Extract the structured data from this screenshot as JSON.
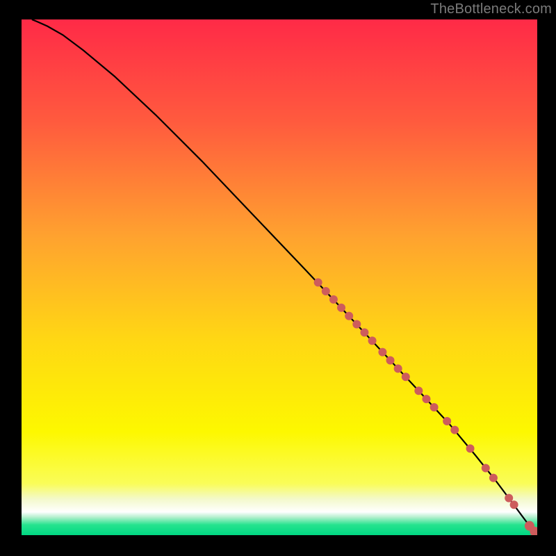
{
  "attribution": "TheBottleneck.com",
  "gradient": {
    "stops": [
      {
        "offset": 0.0,
        "color": "#ff2a47"
      },
      {
        "offset": 0.2,
        "color": "#ff5b3e"
      },
      {
        "offset": 0.42,
        "color": "#ffa22f"
      },
      {
        "offset": 0.62,
        "color": "#ffd714"
      },
      {
        "offset": 0.8,
        "color": "#fdf800"
      },
      {
        "offset": 0.9,
        "color": "#fafd58"
      },
      {
        "offset": 0.93,
        "color": "#f3f9cb"
      },
      {
        "offset": 0.955,
        "color": "#ffffff"
      },
      {
        "offset": 0.965,
        "color": "#b5f0cf"
      },
      {
        "offset": 0.98,
        "color": "#26e38e"
      },
      {
        "offset": 1.0,
        "color": "#00d883"
      }
    ]
  },
  "chart_data": {
    "type": "line",
    "title": "",
    "xlabel": "",
    "ylabel": "",
    "xlim": [
      0,
      100
    ],
    "ylim": [
      0,
      100
    ],
    "series": [
      {
        "name": "curve",
        "x": [
          2,
          3,
          5,
          8,
          12,
          18,
          26,
          35,
          45,
          55,
          63,
          70,
          77,
          83,
          88,
          92,
          95,
          97,
          98.5,
          99.5
        ],
        "y": [
          100,
          99.6,
          98.7,
          97.0,
          94.0,
          89.0,
          81.5,
          72.5,
          62.0,
          51.5,
          43.0,
          35.5,
          28.0,
          21.5,
          15.5,
          10.5,
          6.5,
          3.8,
          1.8,
          0.5
        ]
      }
    ],
    "markers": {
      "name": "highlighted-points",
      "color": "#cd5c5c",
      "points": [
        {
          "x": 57.5,
          "y": 49.0,
          "r": 6
        },
        {
          "x": 59.0,
          "y": 47.3,
          "r": 6
        },
        {
          "x": 60.5,
          "y": 45.7,
          "r": 6
        },
        {
          "x": 62.0,
          "y": 44.1,
          "r": 6
        },
        {
          "x": 63.5,
          "y": 42.5,
          "r": 6
        },
        {
          "x": 65.0,
          "y": 40.9,
          "r": 6
        },
        {
          "x": 66.5,
          "y": 39.3,
          "r": 6
        },
        {
          "x": 68.0,
          "y": 37.7,
          "r": 6
        },
        {
          "x": 70.0,
          "y": 35.5,
          "r": 6
        },
        {
          "x": 71.5,
          "y": 33.9,
          "r": 6
        },
        {
          "x": 73.0,
          "y": 32.3,
          "r": 6
        },
        {
          "x": 74.5,
          "y": 30.7,
          "r": 6
        },
        {
          "x": 77.0,
          "y": 28.0,
          "r": 6
        },
        {
          "x": 78.5,
          "y": 26.4,
          "r": 6
        },
        {
          "x": 80.0,
          "y": 24.8,
          "r": 6
        },
        {
          "x": 82.5,
          "y": 22.1,
          "r": 6
        },
        {
          "x": 84.0,
          "y": 20.4,
          "r": 6
        },
        {
          "x": 87.0,
          "y": 16.8,
          "r": 6
        },
        {
          "x": 90.0,
          "y": 13.0,
          "r": 6
        },
        {
          "x": 91.5,
          "y": 11.1,
          "r": 6
        },
        {
          "x": 94.5,
          "y": 7.2,
          "r": 6
        },
        {
          "x": 95.5,
          "y": 5.9,
          "r": 6
        },
        {
          "x": 98.5,
          "y": 1.8,
          "r": 7
        },
        {
          "x": 99.5,
          "y": 0.7,
          "r": 7
        }
      ]
    }
  }
}
